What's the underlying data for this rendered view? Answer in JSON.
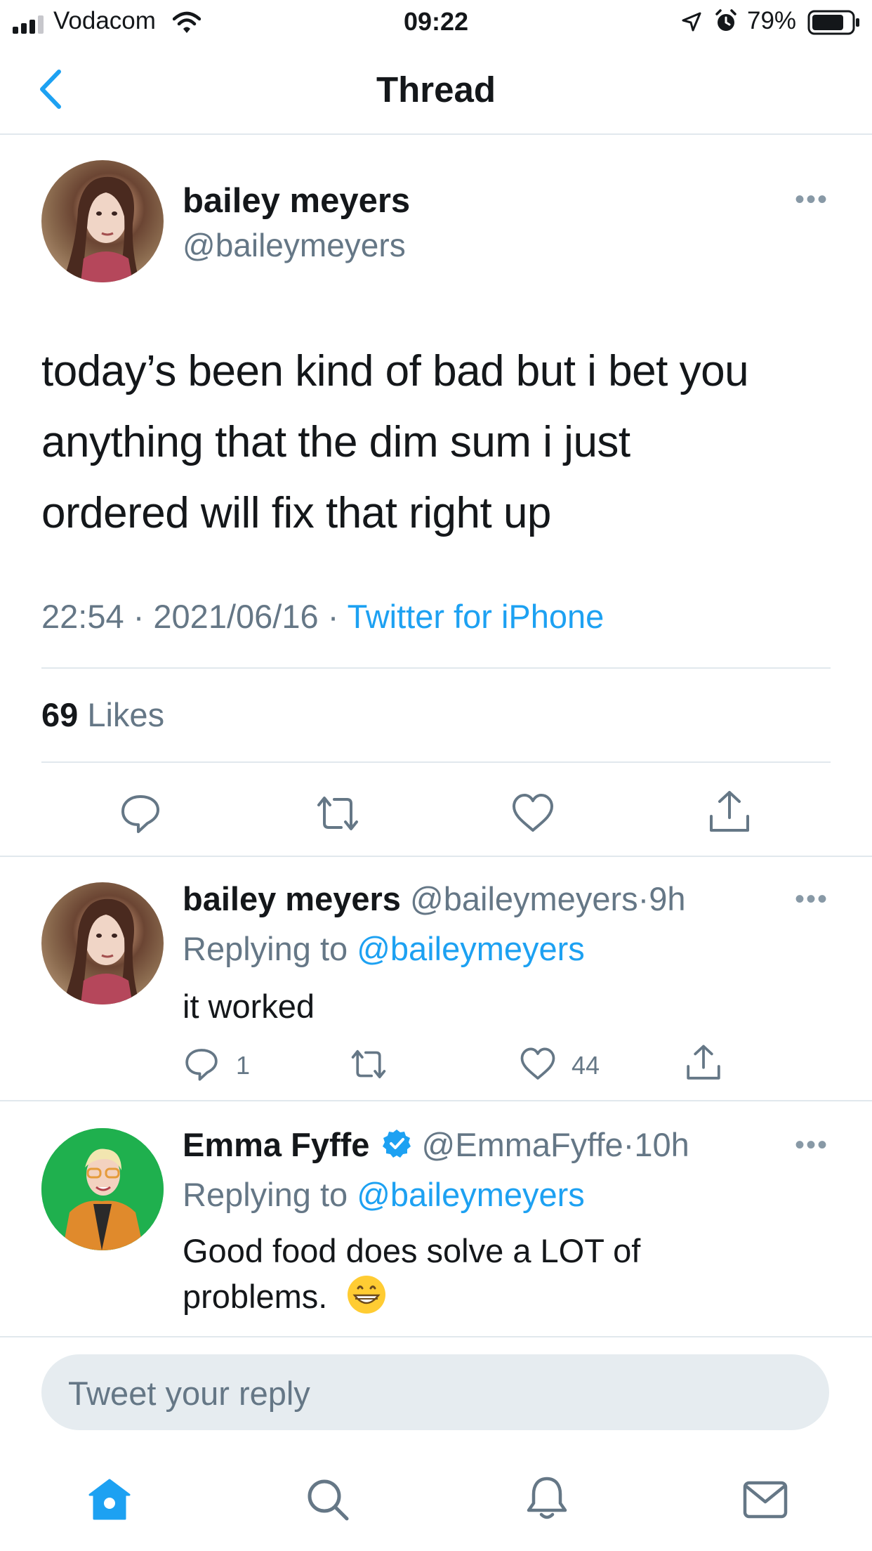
{
  "status_bar": {
    "carrier": "Vodacom",
    "time": "09:22",
    "battery_pct": "79%",
    "icons": [
      "signal-icon",
      "wifi-icon",
      "location-icon",
      "alarm-icon",
      "battery-icon"
    ]
  },
  "header": {
    "title": "Thread",
    "back_icon": "chevron-left-icon"
  },
  "main_tweet": {
    "name": "bailey meyers",
    "handle": "@baileymeyers",
    "text": "today’s been kind of bad but i bet you anything that the dim sum i just ordered will fix that right up",
    "text_lines": [
      "today’s been kind of bad but i bet you",
      "anything that the dim sum i just",
      "ordered will fix that right up"
    ],
    "time": "22:54",
    "date": "2021/06/16",
    "source": "Twitter for iPhone",
    "likes_count": "69",
    "likes_label": "Likes",
    "more_icon": "more-dots-icon",
    "actions": [
      "reply-icon",
      "retweet-icon",
      "like-icon",
      "share-icon"
    ]
  },
  "replies": [
    {
      "name": "bailey meyers",
      "handle": "@baileymeyers",
      "age": "9h",
      "replying_label": "Replying to",
      "replying_to": "@baileymeyers",
      "text": "it worked",
      "reply_count": "1",
      "retweet_count": "",
      "like_count": "44"
    },
    {
      "name": "Emma Fyffe",
      "verified": true,
      "handle": "@EmmaFyffe",
      "age": "10h",
      "replying_label": "Replying to",
      "replying_to": "@baileymeyers",
      "text_line1": "Good food does solve a LOT of",
      "text_line2": "problems.",
      "emoji": "😁"
    }
  ],
  "composer": {
    "placeholder": "Tweet your reply"
  },
  "tab_bar": {
    "items": [
      "home-icon",
      "search-icon",
      "notifications-icon",
      "messages-icon"
    ],
    "active": "home-icon"
  },
  "colors": {
    "accent": "#1da1f2",
    "text": "#14171a",
    "secondary": "#657786",
    "divider": "#e1e8ed"
  }
}
